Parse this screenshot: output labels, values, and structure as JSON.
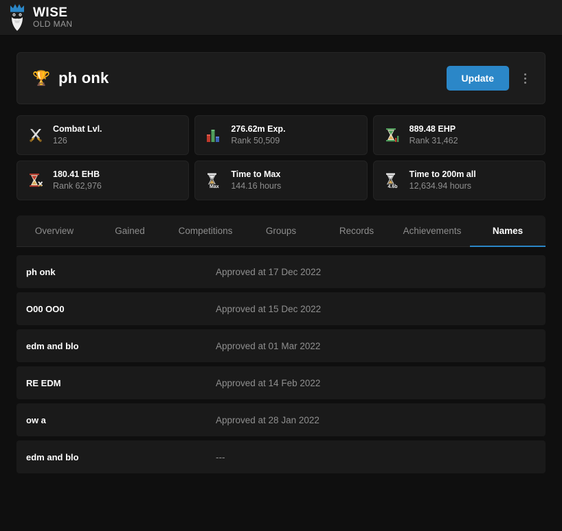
{
  "navbar": {
    "brand_title": "WISE",
    "brand_subtitle": "OLD MAN",
    "logo_icon": "wise-old-man-logo"
  },
  "player": {
    "name": "ph onk",
    "type_icon": "trophy-icon",
    "update_label": "Update",
    "menu_icon": "vertical-dots-icon"
  },
  "stats": [
    {
      "icon": "crossed-swords-icon",
      "title": "Combat Lvl.",
      "sub": "126"
    },
    {
      "icon": "bar-chart-icon",
      "title": "276.62m Exp.",
      "sub": "Rank 50,509"
    },
    {
      "icon": "hourglass-ehp-icon",
      "title": "889.48 EHP",
      "sub": "Rank 31,462"
    },
    {
      "icon": "hourglass-ehb-icon",
      "title": "180.41 EHB",
      "sub": "Rank 62,976"
    },
    {
      "icon": "hourglass-max-icon",
      "title": "Time to Max",
      "sub": "144.16 hours"
    },
    {
      "icon": "hourglass-200m-icon",
      "title": "Time to 200m all",
      "sub": "12,634.94 hours"
    }
  ],
  "tabs": [
    {
      "label": "Overview",
      "active": false
    },
    {
      "label": "Gained",
      "active": false
    },
    {
      "label": "Competitions",
      "active": false
    },
    {
      "label": "Groups",
      "active": false
    },
    {
      "label": "Records",
      "active": false
    },
    {
      "label": "Achievements",
      "active": false
    },
    {
      "label": "Names",
      "active": true
    }
  ],
  "names": [
    {
      "name": "ph onk",
      "status": "Approved at 17 Dec 2022"
    },
    {
      "name": "O00 OO0",
      "status": "Approved at 15 Dec 2022"
    },
    {
      "name": "edm and blo",
      "status": "Approved at 01 Mar 2022"
    },
    {
      "name": "RE EDM",
      "status": "Approved at 14 Feb 2022"
    },
    {
      "name": "ow a",
      "status": "Approved at 28 Jan 2022"
    },
    {
      "name": "edm and blo",
      "status": "---"
    }
  ],
  "colors": {
    "accent": "#2b87c8",
    "page_bg": "#0f0f0f",
    "card_bg": "#1a1a1a",
    "navbar_bg": "#1c1c1c",
    "text_primary": "#ffffff",
    "text_muted": "#8f8f8f"
  }
}
